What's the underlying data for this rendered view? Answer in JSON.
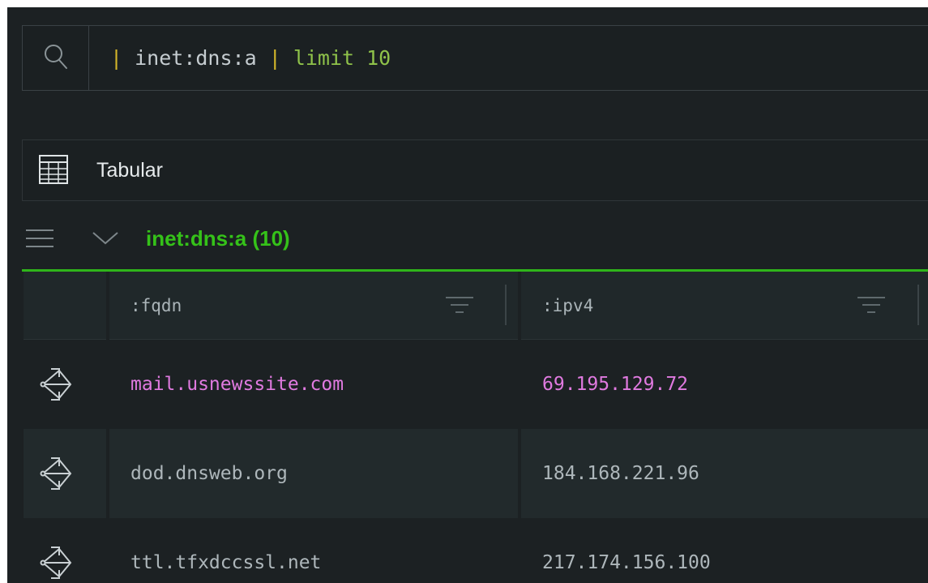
{
  "query": {
    "pipe1": "|",
    "form": "inet:dns:a",
    "pipe2": "|",
    "command": "limit 10"
  },
  "view": {
    "label": "Tabular"
  },
  "group": {
    "title": "inet:dns:a (10)"
  },
  "table": {
    "columns": [
      ":fqdn",
      ":ipv4"
    ],
    "rows": [
      {
        "fqdn": "mail.usnewssite.com",
        "ipv4": "69.195.129.72"
      },
      {
        "fqdn": "dod.dnsweb.org",
        "ipv4": "184.168.221.96"
      },
      {
        "fqdn": "ttl.tfxdccssl.net",
        "ipv4": "217.174.156.100"
      }
    ]
  },
  "colors": {
    "background": "#1c2123",
    "accent_green": "#35c219",
    "highlight_pink": "#e07ae0",
    "pipe_yellow": "#d4b62a",
    "command_green": "#8fc24a"
  },
  "icons": {
    "query": "search-icon",
    "view": "table-grid-icon",
    "group_menu": "hamburger-menu-icon",
    "group_toggle": "chevron-down-icon",
    "column_filter": "filter-icon",
    "row_action": "node-explore-icon"
  }
}
